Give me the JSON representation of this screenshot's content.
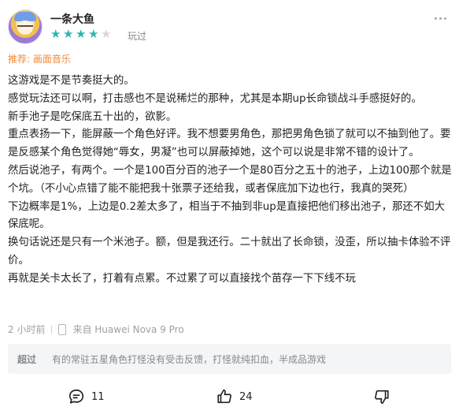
{
  "user": {
    "name": "一条大鱼",
    "rating": 4,
    "rating_max": 5,
    "played_label": "玩过"
  },
  "recommend": {
    "label": "推荐: 画面音乐"
  },
  "review": {
    "paragraphs": [
      "这游戏是不是节奏挺大的。",
      "感觉玩法还可以啊，打击感也不是说稀烂的那种，尤其是本期up长命锁战斗手感挺好的。",
      "新手池子是吃保底五十出的，欲影。",
      "重点表扬一下，能屏蔽一个角色好评。我不想要男角色，那把男角色锁了就可以不抽到他了。要是反感某个角色觉得她“辱女，男凝”也可以屏蔽掉她，这个可以说是非常不错的设计了。",
      "然后说池子，有两个。一个是100百分百的池子一个是80百分之五十的池子，上边100那个就是个坑。（不小心点错了能不能把我十张票子还给我，或者保底加下边也行，我真的哭死）",
      "下边概率是1%，上边是0.2差太多了，相当于不抽到非up是直接把他们移出池子，那还不如大保底呢。",
      "换句话说还是只有一个米池子。额，但是我还行。二十就出了长命锁，没歪，所以抽卡体验不评价。",
      "再就是关卡太长了，打着有点累。不过累了可以直接找个苗存一下下线不玩"
    ]
  },
  "meta": {
    "time": "2 小时前",
    "device": "来自 Huawei Nova 9 Pro"
  },
  "reply": {
    "author": "超过",
    "text": "有的常驻五星角色打怪没有受击反馈，打怪就纯扣血，半成品游戏"
  },
  "actions": {
    "comments_count": "11",
    "likes_count": "24"
  },
  "colors": {
    "star": "#2ab7b2",
    "recommend": "#f08a3a"
  }
}
